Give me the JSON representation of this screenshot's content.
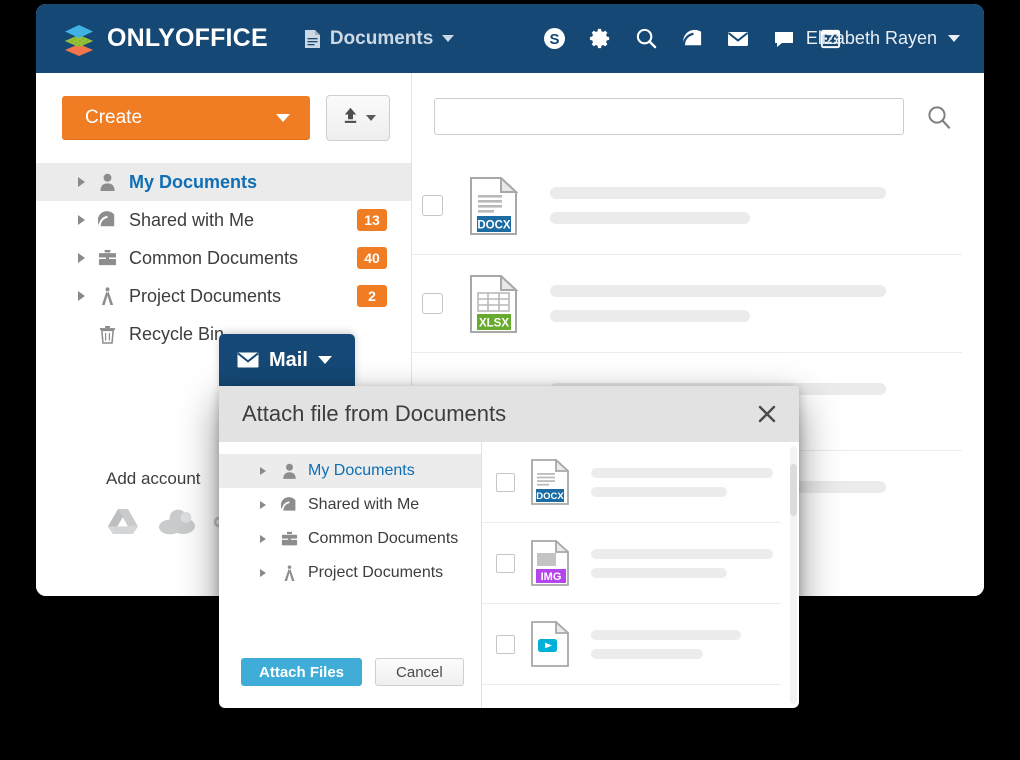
{
  "header": {
    "logo_text": "ONLYOFFICE",
    "logo_icon": "onlyoffice-stack-logo",
    "module": {
      "label": "Documents",
      "icon": "document-icon",
      "caret": "chevron-down-icon"
    },
    "icons": [
      {
        "name": "payments-icon",
        "glyph": "dollar-circle"
      },
      {
        "name": "settings-icon",
        "glyph": "gear"
      },
      {
        "name": "search-icon",
        "glyph": "magnifier"
      },
      {
        "name": "projects-icon",
        "glyph": "gauge"
      },
      {
        "name": "mail-icon",
        "glyph": "envelope"
      },
      {
        "name": "talk-icon",
        "glyph": "speech-bubble"
      },
      {
        "name": "calendar-icon",
        "glyph": "calendar"
      }
    ],
    "user": {
      "name": "Elizabeth Rayen",
      "caret": "chevron-down-icon"
    }
  },
  "toolbar": {
    "create_label": "Create",
    "create_caret": "chevron-down-icon",
    "upload_icon": "upload-icon",
    "upload_caret": "chevron-down-icon"
  },
  "sidebar": {
    "items": [
      {
        "label": "My Documents",
        "icon": "person-icon",
        "badge": "",
        "selected": true,
        "twisty": true
      },
      {
        "label": "Shared with Me",
        "icon": "shared-gauge-icon",
        "badge": "13",
        "selected": false,
        "twisty": true
      },
      {
        "label": "Common Documents",
        "icon": "briefcase-icon",
        "badge": "40",
        "selected": false,
        "twisty": true
      },
      {
        "label": "Project Documents",
        "icon": "compass-icon",
        "badge": "2",
        "selected": false,
        "twisty": true
      },
      {
        "label": "Recycle Bin",
        "icon": "trash-icon",
        "badge": "",
        "selected": false,
        "twisty": false
      }
    ],
    "add_account_label": "Add account",
    "cloud_services": [
      {
        "name": "google-drive-icon"
      },
      {
        "name": "onedrive-cloud-icon"
      },
      {
        "name": "nextcloud-icon"
      }
    ]
  },
  "search": {
    "value": "",
    "placeholder": "",
    "button_icon": "search-icon"
  },
  "file_list": {
    "rows": [
      {
        "ext": "DOCX",
        "ext_color": "#1a6ca3",
        "icon": "docx-file-icon",
        "line1_width": 336,
        "line2_width": 200
      },
      {
        "ext": "XLSX",
        "ext_color": "#67ab2e",
        "icon": "xlsx-file-icon",
        "line1_width": 336,
        "line2_width": 200
      },
      {
        "ext": "",
        "ext_color": "#1a6ca3",
        "icon": "file-icon",
        "line1_width": 336,
        "line2_width": 200
      }
    ]
  },
  "mail_tab": {
    "label": "Mail",
    "icon": "envelope-icon",
    "caret": "chevron-down-icon"
  },
  "modal": {
    "title": "Attach file from Documents",
    "close_icon": "close-icon",
    "tree_items": [
      {
        "label": "My Documents",
        "icon": "person-icon",
        "selected": true
      },
      {
        "label": "Shared with Me",
        "icon": "shared-gauge-icon",
        "selected": false
      },
      {
        "label": "Common Documents",
        "icon": "briefcase-icon",
        "selected": false
      },
      {
        "label": "Project Documents",
        "icon": "compass-icon",
        "selected": false
      }
    ],
    "files": [
      {
        "ext": "DOCX",
        "ext_color": "#1a6ca3",
        "icon": "docx-file-icon",
        "line1_width": 182,
        "line2_width": 136
      },
      {
        "ext": "IMG",
        "ext_color": "#b444ee",
        "icon": "img-file-icon",
        "line1_width": 182,
        "line2_width": 136
      },
      {
        "ext": "VIDEO",
        "ext_color": "#00b0d8",
        "icon": "video-file-icon",
        "line1_width": 150,
        "line2_width": 112
      }
    ],
    "attach_label": "Attach Files",
    "cancel_label": "Cancel"
  },
  "colors": {
    "header_blue": "#154875",
    "accent_orange": "#f07d23",
    "link_blue": "#0f6eb4",
    "primary_button": "#40add8"
  }
}
